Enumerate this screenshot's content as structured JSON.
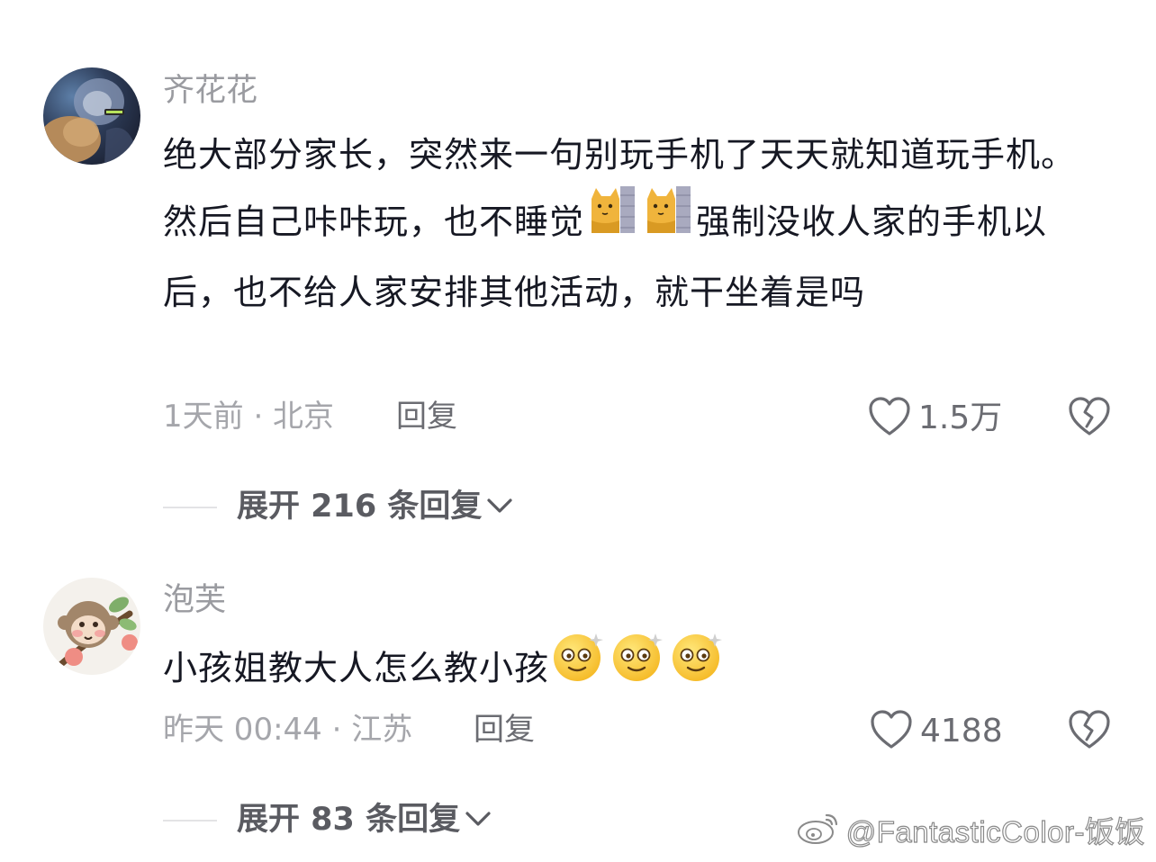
{
  "comments": [
    {
      "author": "齐花花",
      "avatar_icon": "avatar-cat-photo-icon",
      "segments": {
        "a": "绝大部分家长，突然来一句别玩手机了天天就知道玩手机。然后自己咔咔玩，也不睡觉",
        "b": "强制没收人家的手机以后，也不给人家安排其他活动，就干坐着是吗"
      },
      "inline_emojis": [
        "cat-emoji-icon",
        "cat-emoji-icon"
      ],
      "meta": "1天前 · 北京",
      "reply_label": "回复",
      "like_count": "1.5万",
      "expand_label": "展开 216 条回复"
    },
    {
      "author": "泡芙",
      "avatar_icon": "avatar-monkey-illustration-icon",
      "text": "小孩姐教大人怎么教小孩",
      "inline_emojis": [
        "dizzy-face-emoji-icon",
        "dizzy-face-emoji-icon",
        "dizzy-face-emoji-icon"
      ],
      "meta": "昨天 00:44 · 江苏",
      "reply_label": "回复",
      "like_count": "4188",
      "expand_label": "展开 83 条回复"
    }
  ],
  "watermark": "@FantasticColor-饭饭",
  "colors": {
    "text_primary": "#161823",
    "text_secondary": "#9a9ba0",
    "meta_gray": "#a5a6ab",
    "icon_gray": "#6b6c72",
    "divider": "#e3e3e5"
  }
}
